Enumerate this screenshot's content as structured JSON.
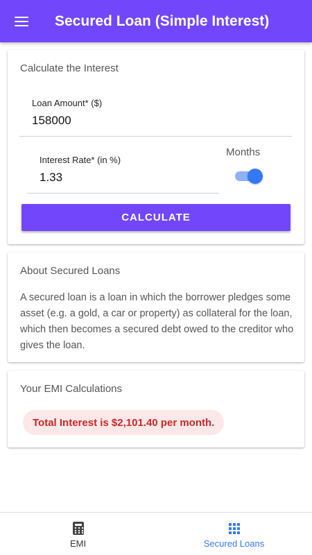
{
  "appbar": {
    "title": "Secured Loan (Simple Interest)",
    "menu_icon": "hamburger-menu-icon",
    "color": "#7247fb"
  },
  "calculator": {
    "title": "Calculate the Interest",
    "loan_amount": {
      "label": "Loan Amount* ($)",
      "value": "158000"
    },
    "interest_rate": {
      "label": "Interest Rate* (in %)",
      "value": "1.33"
    },
    "period_toggle": {
      "label": "Months",
      "on": true
    },
    "button_label": "CALCULATE"
  },
  "about": {
    "title": "About Secured Loans",
    "text": "A secured loan is a loan in which the borrower pledges some asset (e.g. a gold, a car or property) as collateral for the loan, which then becomes a secured debt owed to the creditor who gives the loan."
  },
  "result": {
    "title": "Your EMI Calculations",
    "message": "Total Interest is $2,101.40 per month."
  },
  "bottom_nav": {
    "items": [
      {
        "label": "EMI",
        "icon": "calculator-icon",
        "active": false
      },
      {
        "label": "Secured Loans",
        "icon": "grid-icon",
        "active": true
      }
    ],
    "active_color": "#3478f6"
  }
}
